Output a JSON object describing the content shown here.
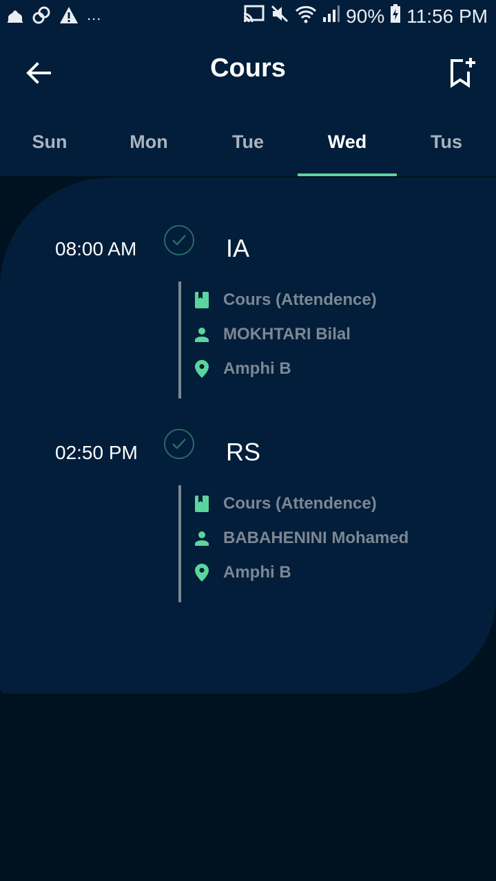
{
  "status_bar": {
    "battery": "90%",
    "time": "11:56 PM",
    "overflow": "..."
  },
  "app_bar": {
    "title": "Cours"
  },
  "tabs": [
    {
      "label": "Sun",
      "active": false
    },
    {
      "label": "Mon",
      "active": false
    },
    {
      "label": "Tue",
      "active": false
    },
    {
      "label": "Wed",
      "active": true
    },
    {
      "label": "Tus",
      "active": false
    }
  ],
  "schedule": [
    {
      "time": "08:00 AM",
      "course": "IA",
      "type": "Cours (Attendence)",
      "teacher": "MOKHTARI Bilal",
      "room": "Amphi B"
    },
    {
      "time": "02:50 PM",
      "course": "RS",
      "type": "Cours (Attendence)",
      "teacher": "BABAHENINI Mohamed",
      "room": "Amphi B"
    }
  ],
  "colors": {
    "accent": "#5ad59b",
    "surface": "#021e3a",
    "background": "#00111f",
    "muted_text": "#7d8792"
  }
}
